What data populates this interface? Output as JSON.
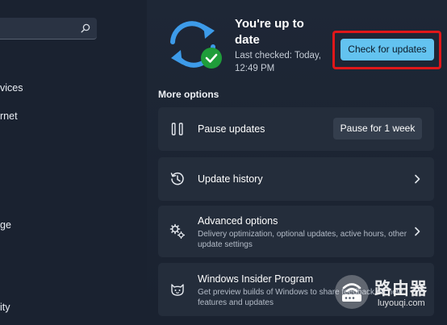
{
  "sidebar": {
    "search": {
      "placeholder": "",
      "icon": "search-icon"
    },
    "items": [
      {
        "label": "vices"
      },
      {
        "label": "rnet"
      },
      {
        "label": "ge"
      },
      {
        "label": "ity"
      }
    ]
  },
  "status": {
    "title": "You're up to date",
    "last_checked": "Last checked: Today, 12:49 PM",
    "icon": "sync-check-icon"
  },
  "actions": {
    "check_label": "Check for updates"
  },
  "more_options": {
    "heading": "More options",
    "pause": {
      "title": "Pause updates",
      "button_label": "Pause for 1 week",
      "icon": "pause-icon"
    },
    "history": {
      "title": "Update history",
      "icon": "history-icon"
    },
    "advanced": {
      "title": "Advanced options",
      "description": "Delivery optimization, optional updates, active hours, other update settings",
      "icon": "gears-icon"
    },
    "insider": {
      "title": "Windows Insider Program",
      "description": "Get preview builds of Windows to share feedback on new features and updates",
      "icon": "insider-cat-icon"
    }
  },
  "watermark": {
    "name": "路由器",
    "url": "luyouqi.com"
  },
  "colors": {
    "accent": "#63c3f0",
    "highlight": "#e0171a",
    "card": "#242d3b",
    "background": "#1b2433",
    "success": "#1f9d3a"
  }
}
